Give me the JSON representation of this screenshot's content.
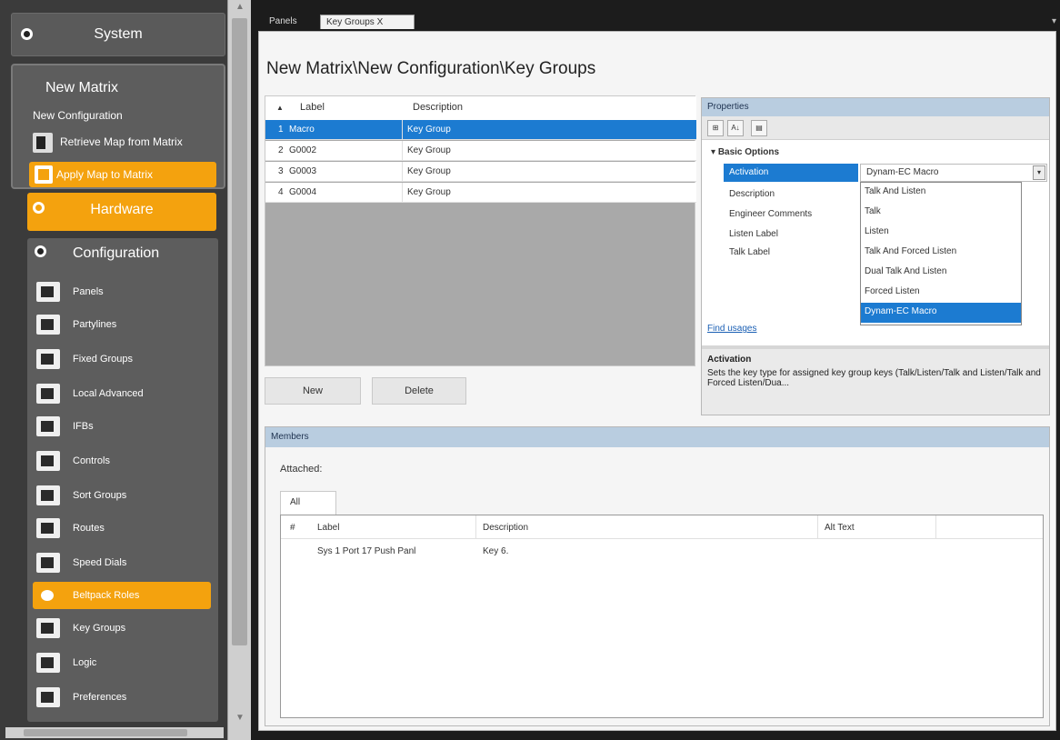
{
  "nav": {
    "system_label": "System",
    "matrix_title": "New Matrix",
    "configuration_name": "New Configuration",
    "retrieve_label": "Retrieve Map from Matrix",
    "apply_label": "Apply Map to Matrix",
    "hardware_label": "Hardware",
    "configuration_label": "Configuration",
    "items": [
      {
        "label": "Panels"
      },
      {
        "label": "Partylines"
      },
      {
        "label": "Fixed Groups"
      },
      {
        "label": "Local Advanced"
      },
      {
        "label": "IFBs"
      },
      {
        "label": "Controls"
      },
      {
        "label": "Sort Groups"
      },
      {
        "label": "Routes"
      },
      {
        "label": "Speed Dials"
      },
      {
        "label": "Beltpack Roles"
      },
      {
        "label": "Key Groups"
      },
      {
        "label": "Logic"
      },
      {
        "label": "Preferences"
      }
    ],
    "active_item": "Beltpack Roles"
  },
  "tabs": {
    "panels": "Panels",
    "key_groups": "Key Groups",
    "close_glyph": "X",
    "overflow_glyph": "▾"
  },
  "page": {
    "title": "New Matrix\\New Configuration\\Key Groups"
  },
  "grid": {
    "sort_glyph": "▲",
    "columns": [
      "Label",
      "Description"
    ],
    "rows": [
      {
        "num": "1",
        "label": "Macro",
        "description": "Key Group",
        "selected": true
      },
      {
        "num": "2",
        "label": "G0002",
        "description": "Key Group"
      },
      {
        "num": "3",
        "label": "G0003",
        "description": "Key Group"
      },
      {
        "num": "4",
        "label": "G0004",
        "description": "Key Group"
      }
    ]
  },
  "buttons": {
    "new": "New",
    "delete": "Delete"
  },
  "properties": {
    "header": "Properties",
    "tool_categorized": "⊞",
    "tool_alpha": "A↓",
    "tool_pages": "▤",
    "category": "Basic Options",
    "names": [
      "Activation",
      "Description",
      "Engineer Comments",
      "Listen Label",
      "Talk Label"
    ],
    "activation_value": "Dynam-EC Macro",
    "dropdown_glyph": "▾",
    "options": [
      "Talk And Listen",
      "Talk",
      "Listen",
      "Talk And Forced Listen",
      "Dual Talk And Listen",
      "Forced Listen",
      "Dynam-EC Macro"
    ],
    "selected_option": "Dynam-EC Macro",
    "find_usages": "Find usages",
    "help_title": "Activation",
    "help_text": "Sets the key type for assigned key group keys (Talk/Listen/Talk and Listen/Talk and Forced Listen/Dua..."
  },
  "members": {
    "header": "Members",
    "attached_label": "Attached:",
    "tab_all": "All",
    "columns": [
      "#",
      "Label",
      "Description",
      "Alt Text"
    ],
    "rows": [
      {
        "label": "Sys 1 Port 17 Push Panl",
        "description": "Key 6."
      }
    ]
  },
  "colors": {
    "accent_orange": "#f4a20e",
    "selection_blue": "#1c7bd1",
    "panel_header": "#b9cde0"
  }
}
